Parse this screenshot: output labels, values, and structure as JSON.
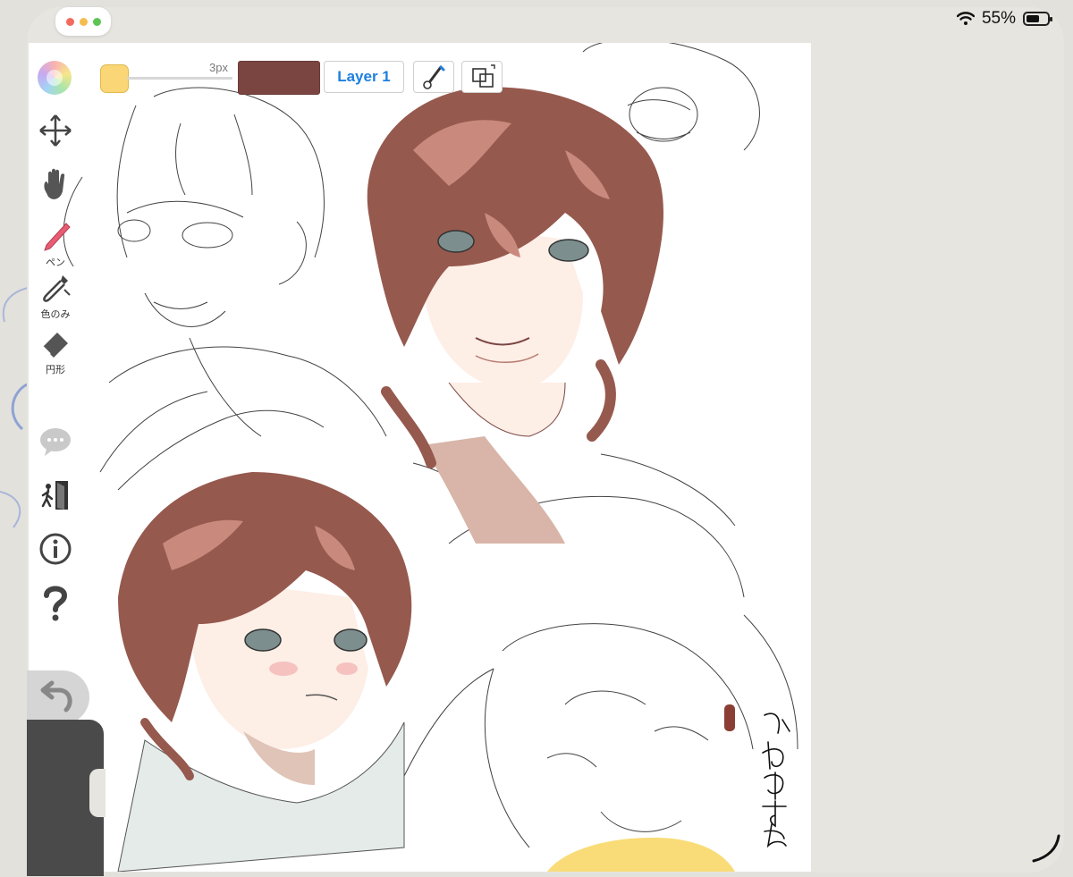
{
  "status_bar": {
    "battery_percent": "55%",
    "wifi_icon": "wifi-icon",
    "battery_icon": "battery-icon"
  },
  "window_controls": {
    "colors": [
      "#f26b5e",
      "#f4bd4f",
      "#5ec455"
    ]
  },
  "toolbar": {
    "brush_size": "3px",
    "layer_label": "Layer 1",
    "secondary_color": "#fbd676",
    "primary_color": "#7a4541",
    "icons": [
      "palette-icon",
      "color-swatch-icon",
      "brush-settings-icon",
      "transform-icon"
    ]
  },
  "side_tools": [
    {
      "id": "move",
      "icon": "move-arrows-icon",
      "label": ""
    },
    {
      "id": "hand",
      "icon": "hand-icon",
      "label": ""
    },
    {
      "id": "pen",
      "icon": "pen-icon",
      "label": "ペン"
    },
    {
      "id": "fill",
      "icon": "dropper-icon",
      "label": "色のみ"
    },
    {
      "id": "eraser",
      "icon": "eraser-icon",
      "label": "円形"
    },
    {
      "id": "chat",
      "icon": "chat-bubble-icon",
      "label": ""
    },
    {
      "id": "exit",
      "icon": "exit-door-icon",
      "label": ""
    },
    {
      "id": "info",
      "icon": "info-icon",
      "label": ""
    },
    {
      "id": "help",
      "icon": "question-icon",
      "label": ""
    },
    {
      "id": "undo",
      "icon": "undo-icon",
      "label": ""
    }
  ],
  "canvas": {
    "background": "#ffffff",
    "hair_color": "#96594e",
    "hair_highlight": "#c98a7d",
    "skin_shadow": "#d8b5a8",
    "skin_base": "#fdeee6",
    "signature_text": "かわゆすぎ"
  }
}
